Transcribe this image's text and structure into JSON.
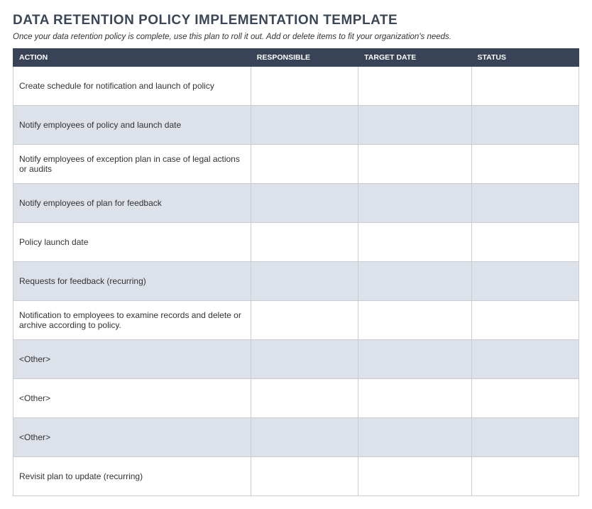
{
  "title": "DATA RETENTION POLICY IMPLEMENTATION TEMPLATE",
  "subtitle": "Once your data retention policy is complete, use this plan to roll it out.  Add or delete items to fit your organization's needs.",
  "headers": {
    "action": "ACTION",
    "responsible": "RESPONSIBLE",
    "target_date": "TARGET DATE",
    "status": "STATUS"
  },
  "rows": [
    {
      "action": "Create schedule for notification and launch of policy",
      "responsible": "",
      "target_date": "",
      "status": ""
    },
    {
      "action": "Notify employees of policy and launch date",
      "responsible": "",
      "target_date": "",
      "status": ""
    },
    {
      "action": "Notify employees of exception plan in case of legal actions or audits",
      "responsible": "",
      "target_date": "",
      "status": ""
    },
    {
      "action": "Notify employees of plan for feedback",
      "responsible": "",
      "target_date": "",
      "status": ""
    },
    {
      "action": "Policy launch date",
      "responsible": "",
      "target_date": "",
      "status": ""
    },
    {
      "action": "Requests for feedback (recurring)",
      "responsible": "",
      "target_date": "",
      "status": ""
    },
    {
      "action": "Notification to employees to examine records and delete or archive according to policy.",
      "responsible": "",
      "target_date": "",
      "status": ""
    },
    {
      "action": "<Other>",
      "responsible": "",
      "target_date": "",
      "status": ""
    },
    {
      "action": "<Other>",
      "responsible": "",
      "target_date": "",
      "status": ""
    },
    {
      "action": "<Other>",
      "responsible": "",
      "target_date": "",
      "status": ""
    },
    {
      "action": "Revisit plan to update (recurring)",
      "responsible": "",
      "target_date": "",
      "status": ""
    }
  ]
}
